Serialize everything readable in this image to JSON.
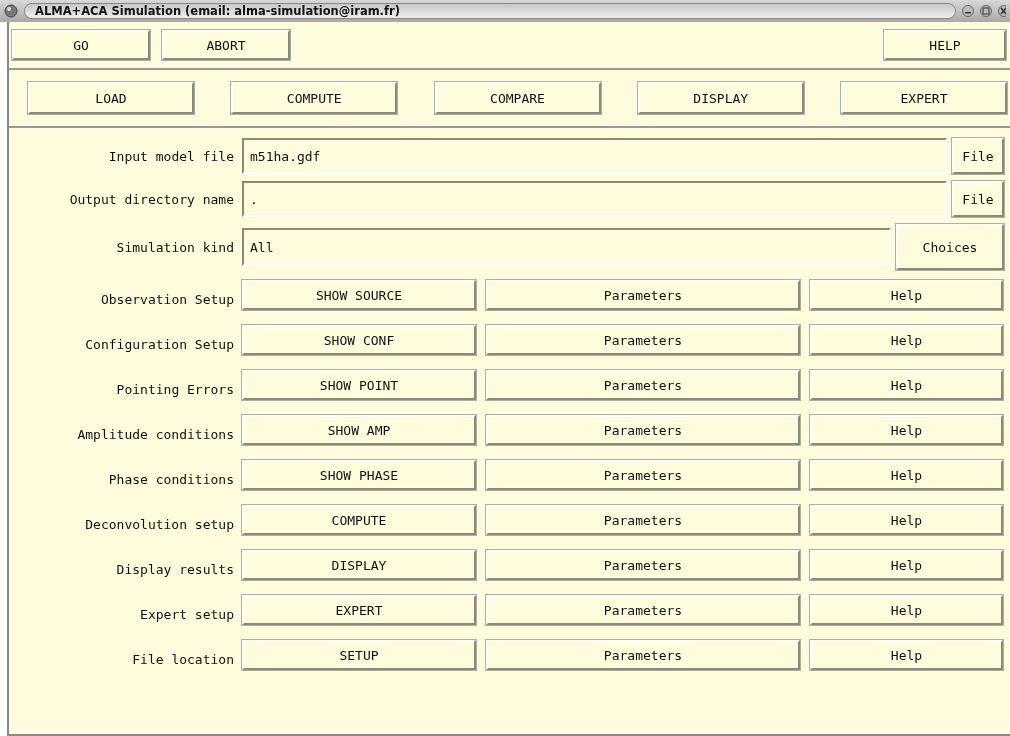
{
  "window": {
    "title": "ALMA+ACA Simulation (email: alma-simulation@iram.fr)"
  },
  "top_buttons": {
    "left": [
      "GO",
      "ABORT"
    ],
    "right": [
      "HELP"
    ]
  },
  "main_buttons": [
    "LOAD",
    "COMPUTE",
    "COMPARE",
    "DISPLAY",
    "EXPERT"
  ],
  "fields": [
    {
      "label": "Input model file",
      "value": "m51ha.gdf",
      "button": "File",
      "kind": "file"
    },
    {
      "label": "Output directory name",
      "value": ".",
      "button": "File",
      "kind": "file"
    },
    {
      "label": "Simulation kind",
      "value": "All",
      "button": "Choices",
      "kind": "choice"
    }
  ],
  "sections": [
    {
      "label": "Observation Setup",
      "action": "SHOW SOURCE",
      "parameters": "Parameters",
      "help": "Help"
    },
    {
      "label": "Configuration Setup",
      "action": "SHOW CONF",
      "parameters": "Parameters",
      "help": "Help"
    },
    {
      "label": "Pointing Errors",
      "action": "SHOW POINT",
      "parameters": "Parameters",
      "help": "Help"
    },
    {
      "label": "Amplitude conditions",
      "action": "SHOW AMP",
      "parameters": "Parameters",
      "help": "Help"
    },
    {
      "label": "Phase conditions",
      "action": "SHOW PHASE",
      "parameters": "Parameters",
      "help": "Help"
    },
    {
      "label": "Deconvolution setup",
      "action": "COMPUTE",
      "parameters": "Parameters",
      "help": "Help"
    },
    {
      "label": "Display results",
      "action": "DISPLAY",
      "parameters": "Parameters",
      "help": "Help"
    },
    {
      "label": "Expert setup",
      "action": "EXPERT",
      "parameters": "Parameters",
      "help": "Help"
    },
    {
      "label": "File location",
      "action": "SETUP",
      "parameters": "Parameters",
      "help": "Help"
    }
  ]
}
